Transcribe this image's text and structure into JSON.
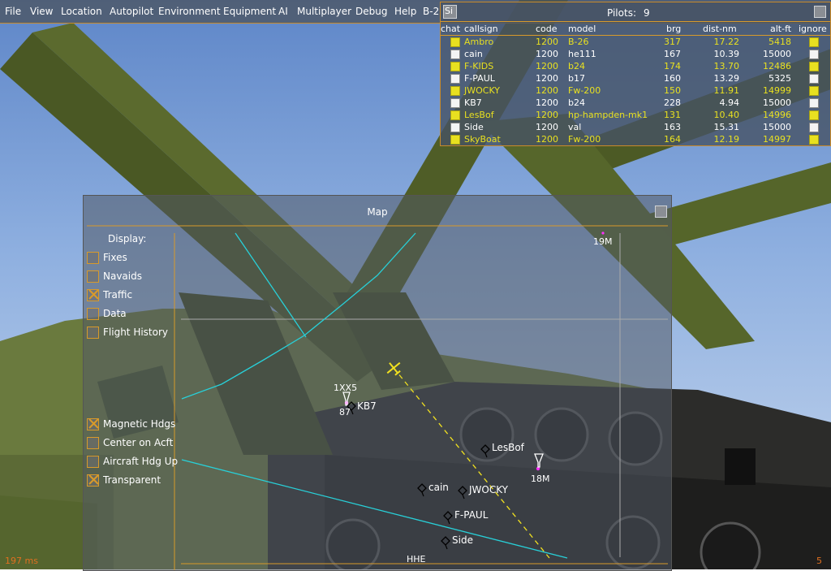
{
  "menu": {
    "items": [
      "File",
      "View",
      "Location",
      "Autopilot",
      "Environment",
      "Equipment",
      "AI",
      "Multiplayer",
      "Debug",
      "Help",
      "B-2"
    ]
  },
  "pilots": {
    "si_label": "Si",
    "title": "Pilots:",
    "count": "9",
    "headers": {
      "chat": "chat",
      "callsign": "callsign",
      "code": "code",
      "model": "model",
      "brg": "brg",
      "dist": "dist-nm",
      "alt": "alt-ft",
      "ignore": "ignore"
    },
    "rows": [
      {
        "chat": true,
        "callsign": "Ambro",
        "code": "1200",
        "model": "B-26",
        "brg": "317",
        "dist": "17.22",
        "alt": "5418",
        "ignore": true,
        "highlight": true
      },
      {
        "chat": false,
        "callsign": "cain",
        "code": "1200",
        "model": "he111",
        "brg": "167",
        "dist": "10.39",
        "alt": "15000",
        "ignore": false,
        "highlight": false
      },
      {
        "chat": true,
        "callsign": "F-KIDS",
        "code": "1200",
        "model": "b24",
        "brg": "174",
        "dist": "13.70",
        "alt": "12486",
        "ignore": true,
        "highlight": true
      },
      {
        "chat": false,
        "callsign": "F-PAUL",
        "code": "1200",
        "model": "b17",
        "brg": "160",
        "dist": "13.29",
        "alt": "5325",
        "ignore": false,
        "highlight": false
      },
      {
        "chat": true,
        "callsign": "JWOCKY",
        "code": "1200",
        "model": "Fw-200",
        "brg": "150",
        "dist": "11.91",
        "alt": "14999",
        "ignore": true,
        "highlight": true
      },
      {
        "chat": false,
        "callsign": "KB7",
        "code": "1200",
        "model": "b24",
        "brg": "228",
        "dist": "4.94",
        "alt": "15000",
        "ignore": false,
        "highlight": false
      },
      {
        "chat": true,
        "callsign": "LesBof",
        "code": "1200",
        "model": "hp-hampden-mk1",
        "brg": "131",
        "dist": "10.40",
        "alt": "14996",
        "ignore": true,
        "highlight": true
      },
      {
        "chat": false,
        "callsign": "Side",
        "code": "1200",
        "model": "val",
        "brg": "163",
        "dist": "15.31",
        "alt": "15000",
        "ignore": false,
        "highlight": false
      },
      {
        "chat": true,
        "callsign": "SkyBoat",
        "code": "1200",
        "model": "Fw-200",
        "brg": "164",
        "dist": "12.19",
        "alt": "14997",
        "ignore": true,
        "highlight": true
      }
    ]
  },
  "map": {
    "title": "Map",
    "display_label": "Display:",
    "options_top": [
      {
        "label": "Fixes",
        "checked": false
      },
      {
        "label": "Navaids",
        "checked": false
      },
      {
        "label": "Traffic",
        "checked": true
      },
      {
        "label": "Data",
        "checked": false
      },
      {
        "label": "Flight History",
        "checked": false
      }
    ],
    "options_bottom": [
      {
        "label": "Magnetic Hdgs",
        "checked": true
      },
      {
        "label": "Center on Acft",
        "checked": false
      },
      {
        "label": "Aircraft Hdg Up",
        "checked": false
      },
      {
        "label": "Transparent",
        "checked": true
      }
    ],
    "labels": {
      "m19": "19M",
      "m18": "18M",
      "kb7_id": "1XX5",
      "kb7_num": "87",
      "bottom_fix": "HHE"
    },
    "traffic": [
      "KB7",
      "LesBof",
      "cain",
      "JWOCKY",
      "F-PAUL",
      "Side"
    ]
  },
  "status": {
    "frame_time": "197 ms",
    "right_value": "5"
  },
  "colors": {
    "accent": "#d89a2a",
    "highlight_text": "#e8e020",
    "route": "#28d0d8",
    "own_track": "#f0e020"
  }
}
